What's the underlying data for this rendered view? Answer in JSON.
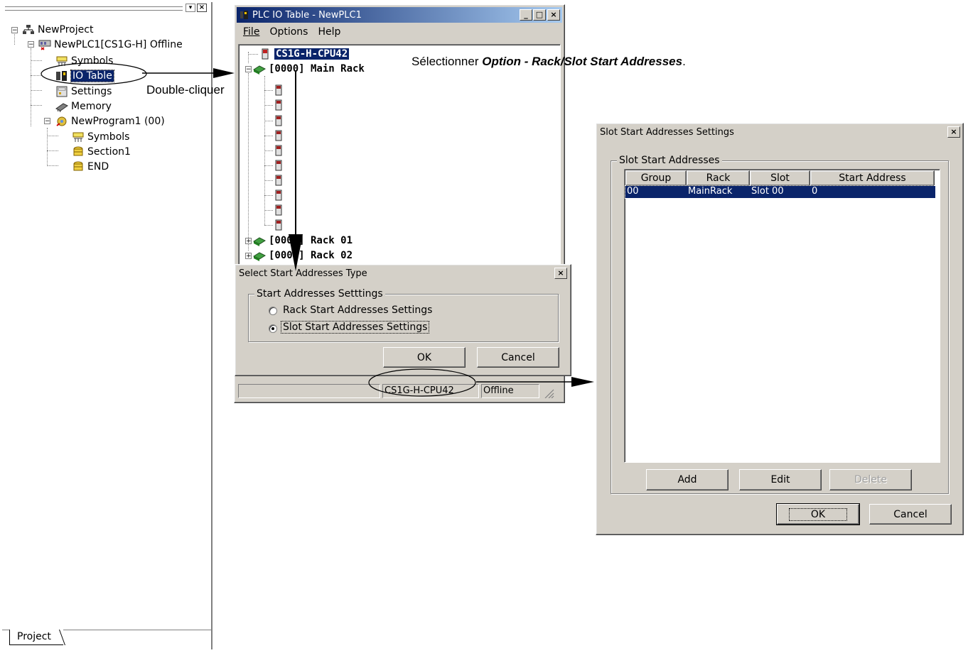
{
  "project_pane": {
    "tab_label": "Project",
    "tree": [
      {
        "label": "NewProject",
        "icon": "network-icon"
      },
      {
        "label": "NewPLC1[CS1G-H] Offline",
        "icon": "plc-icon"
      },
      {
        "label": "Symbols",
        "icon": "symbols-icon"
      },
      {
        "label": "IO Table",
        "icon": "io-table-icon"
      },
      {
        "label": "Settings",
        "icon": "settings-icon"
      },
      {
        "label": "Memory",
        "icon": "memory-icon"
      },
      {
        "label": "NewProgram1 (00)",
        "icon": "program-icon"
      },
      {
        "label": "Symbols",
        "icon": "symbols-icon"
      },
      {
        "label": "Section1",
        "icon": "section-icon"
      },
      {
        "label": "END",
        "icon": "section-icon"
      }
    ]
  },
  "annotations": {
    "double_click": "Double-cliquer",
    "select_prefix": "Sélectionner ",
    "select_emphasis": "Option - Rack/Slot Start Addresses",
    "select_suffix": "."
  },
  "io_window": {
    "title": "PLC IO Table - NewPLC1",
    "menu": [
      "File",
      "Options",
      "Help"
    ],
    "tree": {
      "cpu": "CS1G-H-CPU42",
      "main_rack": "[0000] Main Rack",
      "rack01": "[0000] Rack 01",
      "rack02": "[0000] Rack 02"
    },
    "status": {
      "model": "CS1G-H-CPU42",
      "mode": "Offline"
    }
  },
  "select_dialog": {
    "title": "Select Start Addresses Type",
    "group_label": "Start Addresses Setttings",
    "options": [
      "Rack Start Addresses Settings",
      "Slot Start Addresses Settings"
    ],
    "selected_index": 1,
    "ok": "OK",
    "cancel": "Cancel"
  },
  "slot_dialog": {
    "title": "Slot Start Addresses Settings",
    "group_label": "Slot Start Addresses",
    "columns": [
      "Group",
      "Rack",
      "Slot",
      "Start Address"
    ],
    "rows": [
      {
        "group": "00",
        "rack": "MainRack",
        "slot": "Slot 00",
        "start": "0"
      }
    ],
    "buttons": {
      "add": "Add",
      "edit": "Edit",
      "delete": "Delete",
      "ok": "OK",
      "cancel": "Cancel"
    }
  },
  "colors": {
    "selection": "#0a246a",
    "title_active": "#0a246a",
    "face": "#d4d0c8"
  }
}
